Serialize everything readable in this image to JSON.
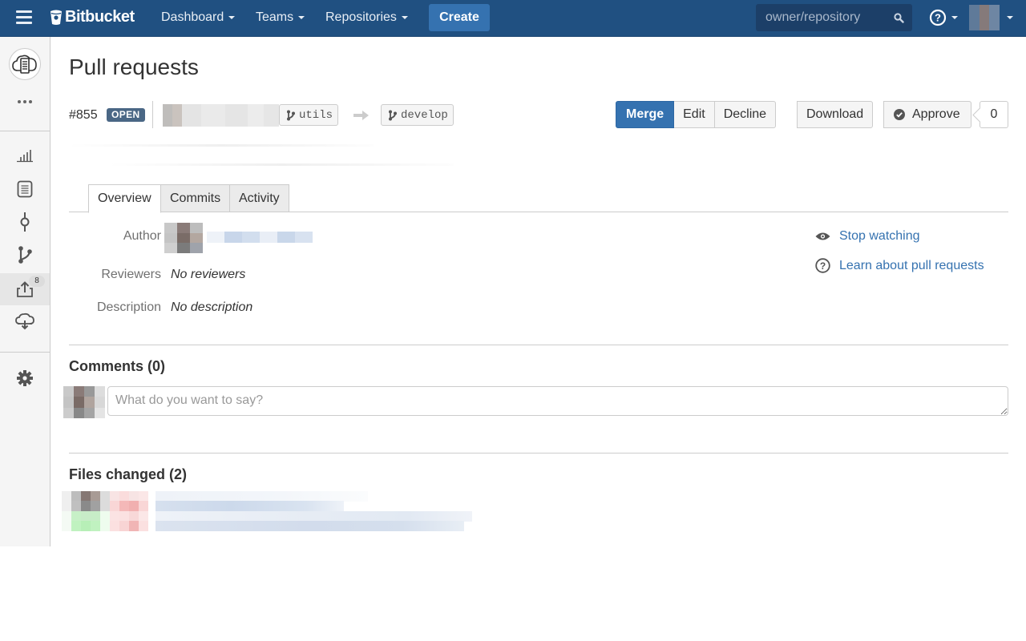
{
  "topbar": {
    "brand": "Bitbucket",
    "nav": [
      {
        "label": "Dashboard"
      },
      {
        "label": "Teams"
      },
      {
        "label": "Repositories"
      }
    ],
    "create_label": "Create",
    "search_placeholder": "owner/repository",
    "colors": {
      "bar": "#205081",
      "create": "#3572b0"
    }
  },
  "sidebar": {
    "items": [
      {
        "name": "overview",
        "icon": "cloud-repo-icon"
      },
      {
        "name": "more",
        "icon": "ellipsis-icon"
      },
      {
        "name": "statistics",
        "icon": "bar-chart-icon"
      },
      {
        "name": "source",
        "icon": "document-icon"
      },
      {
        "name": "commits",
        "icon": "commit-icon"
      },
      {
        "name": "branches",
        "icon": "branch-icon"
      },
      {
        "name": "pull-requests",
        "icon": "pull-request-icon",
        "badge": "8",
        "active": true
      },
      {
        "name": "downloads",
        "icon": "cloud-download-icon"
      },
      {
        "name": "settings",
        "icon": "gear-icon"
      }
    ]
  },
  "page": {
    "title": "Pull requests",
    "pr_id": "#855",
    "status": "OPEN",
    "source_branch": "utils",
    "target_branch": "develop",
    "actions": {
      "merge": "Merge",
      "edit": "Edit",
      "decline": "Decline",
      "download": "Download",
      "approve": "Approve",
      "approve_count": "0"
    },
    "tabs": [
      {
        "label": "Overview",
        "active": true
      },
      {
        "label": "Commits",
        "active": false
      },
      {
        "label": "Activity",
        "active": false
      }
    ],
    "fields": {
      "author_label": "Author",
      "reviewers_label": "Reviewers",
      "reviewers_value": "No reviewers",
      "description_label": "Description",
      "description_value": "No description"
    },
    "side_links": {
      "watch": "Stop watching",
      "learn": "Learn about pull requests"
    },
    "comments": {
      "heading": "Comments (0)",
      "placeholder": "What do you want to say?"
    },
    "files": {
      "heading": "Files changed (2)"
    }
  }
}
